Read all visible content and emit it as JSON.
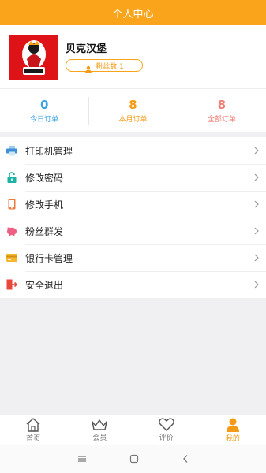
{
  "header": {
    "title": "个人中心"
  },
  "profile": {
    "shop_name": "贝克汉堡",
    "fans_label": "粉丝数 1",
    "logo_text": "贝克汉堡"
  },
  "stats": [
    {
      "value": "0",
      "label": "今日订单"
    },
    {
      "value": "8",
      "label": "本月订单"
    },
    {
      "value": "8",
      "label": "全部订单"
    }
  ],
  "menu": [
    {
      "label": "打印机管理",
      "icon": "printer-icon"
    },
    {
      "label": "修改密码",
      "icon": "lock-icon"
    },
    {
      "label": "修改手机",
      "icon": "phone-icon"
    },
    {
      "label": "粉丝群发",
      "icon": "piggy-bank-icon"
    },
    {
      "label": "银行卡管理",
      "icon": "bank-card-icon"
    },
    {
      "label": "安全退出",
      "icon": "logout-icon"
    }
  ],
  "tabs": [
    {
      "label": "首页",
      "icon": "home-icon"
    },
    {
      "label": "会员",
      "icon": "crown-icon"
    },
    {
      "label": "评价",
      "icon": "heart-icon"
    },
    {
      "label": "我的",
      "icon": "user-icon"
    }
  ],
  "colors": {
    "accent": "#f9a41a",
    "stat_today": "#3aa3e3",
    "stat_month": "#f39a16",
    "stat_all": "#f07b73"
  }
}
